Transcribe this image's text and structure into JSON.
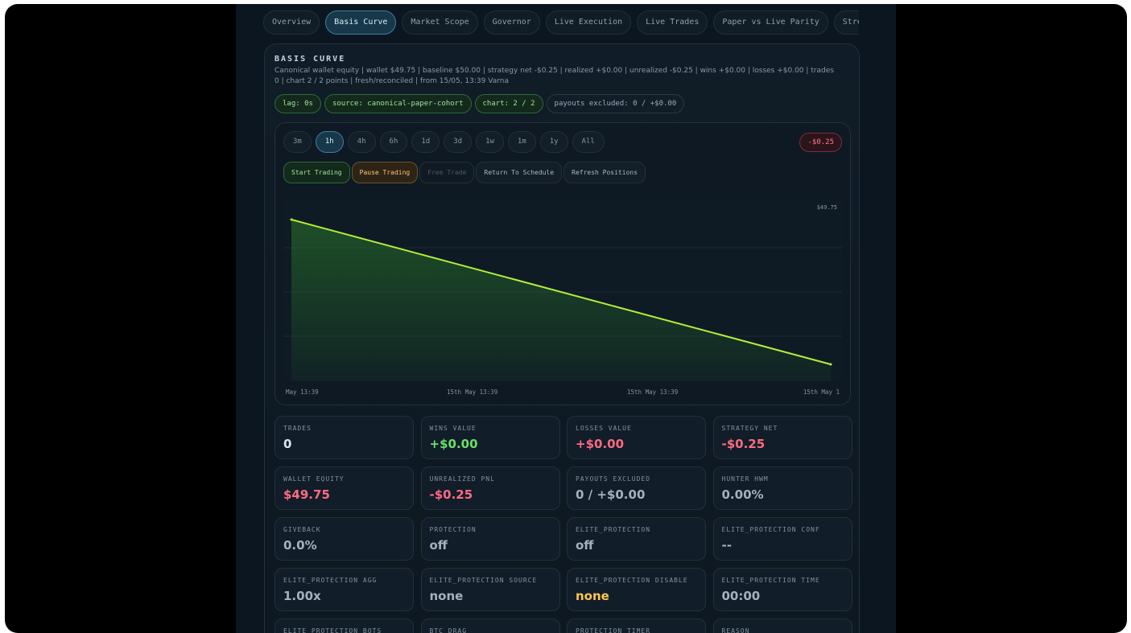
{
  "tabs": [
    "Overview",
    "Basis Curve",
    "Market Scope",
    "Governor",
    "Live Execution",
    "Live Trades",
    "Paper vs Live Parity",
    "Stre"
  ],
  "active_tab": "Basis Curve",
  "panel": {
    "title": "BASIS CURVE",
    "subtitle": "Canonical wallet equity | wallet $49.75 | baseline $50.00 | strategy net -$0.25 | realized +$0.00 | unrealized -$0.25 | wins +$0.00 | losses +$0.00 | trades 0 | chart 2 / 2 points | fresh/reconciled | from 15/05, 13:39 Varna",
    "chips": [
      {
        "label": "lag: 0s",
        "style": "green"
      },
      {
        "label": "source: canonical-paper-cohort",
        "style": "green"
      },
      {
        "label": "chart: 2 / 2",
        "style": "green"
      },
      {
        "label": "payouts excluded: 0 / +$0.00",
        "style": "plain"
      }
    ]
  },
  "ranges": [
    "3m",
    "1h",
    "4h",
    "6h",
    "1d",
    "3d",
    "1w",
    "1m",
    "1y",
    "All"
  ],
  "active_range": "1h",
  "pnl_badge": "-$0.25",
  "actions": [
    {
      "label": "Start Trading",
      "style": "green"
    },
    {
      "label": "Pause Trading",
      "style": "amber"
    },
    {
      "label": "Free Trade",
      "style": "disabled"
    },
    {
      "label": "Return To Schedule",
      "style": "plain"
    },
    {
      "label": "Refresh Positions",
      "style": "plain"
    }
  ],
  "chart_data": {
    "type": "area",
    "x": [
      "May 13:39",
      "15th May 13:39"
    ],
    "values": [
      50.0,
      49.75
    ],
    "last_value_label": "$49.75",
    "x_tick_labels": [
      "May 13:39",
      "15th May 13:39",
      "15th May 13:39",
      "15th May 1"
    ],
    "grid": true,
    "colors": {
      "line": "#b4f03a",
      "fill": "#2a7a2a"
    }
  },
  "metrics": [
    {
      "label": "TRADES",
      "value": "0",
      "tone": "plain"
    },
    {
      "label": "WINS VALUE",
      "value": "+$0.00",
      "tone": "pos"
    },
    {
      "label": "LOSSES VALUE",
      "value": "+$0.00",
      "tone": "neg"
    },
    {
      "label": "STRATEGY NET",
      "value": "-$0.25",
      "tone": "neg"
    },
    {
      "label": "WALLET EQUITY",
      "value": "$49.75",
      "tone": "neg"
    },
    {
      "label": "UNREALIZED PNL",
      "value": "-$0.25",
      "tone": "neg"
    },
    {
      "label": "PAYOUTS EXCLUDED",
      "value": "0 / +$0.00",
      "tone": "muted"
    },
    {
      "label": "HUNTER HWM",
      "value": "0.00%",
      "tone": "muted"
    },
    {
      "label": "GIVEBACK",
      "value": "0.0%",
      "tone": "muted"
    },
    {
      "label": "PROTECTION",
      "value": "off",
      "tone": "muted"
    },
    {
      "label": "ELITE_PROTECTION",
      "value": "off",
      "tone": "muted"
    },
    {
      "label": "ELITE_PROTECTION CONF",
      "value": "--",
      "tone": "muted"
    },
    {
      "label": "ELITE_PROTECTION AGG",
      "value": "1.00x",
      "tone": "muted"
    },
    {
      "label": "ELITE_PROTECTION SOURCE",
      "value": "none",
      "tone": "muted"
    },
    {
      "label": "ELITE_PROTECTION DISABLE",
      "value": "none",
      "tone": "warn"
    },
    {
      "label": "ELITE_PROTECTION TIME",
      "value": "00:00",
      "tone": "muted"
    },
    {
      "label": "ELITE_PROTECTION BOTS",
      "value": "",
      "tone": "muted"
    },
    {
      "label": "BTC DRAG",
      "value": "",
      "tone": "muted"
    },
    {
      "label": "PROTECTION TIMER",
      "value": "",
      "tone": "muted"
    },
    {
      "label": "REASON",
      "value": "",
      "tone": "muted"
    }
  ]
}
